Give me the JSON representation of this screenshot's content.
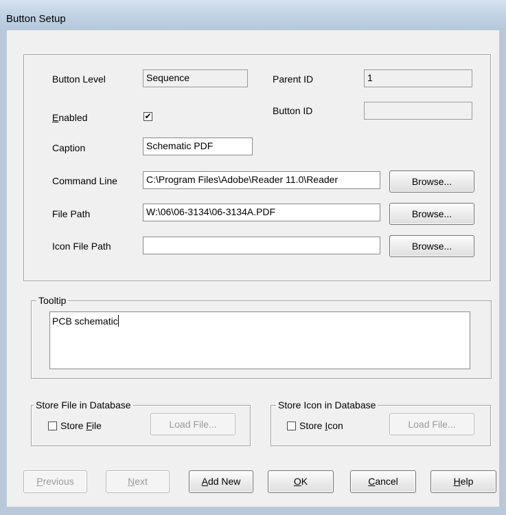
{
  "window": {
    "title": "Button Setup"
  },
  "fields": {
    "button_level_label": "Button Level",
    "button_level_value": "Sequence",
    "parent_id_label": "Parent ID",
    "parent_id_value": "1",
    "enabled_label_mnemonic": "E",
    "enabled_label_rest": "nabled",
    "enabled_checked": true,
    "enabled_mark": "✔",
    "button_id_label": "Button ID",
    "button_id_value": "",
    "caption_label": "Caption",
    "caption_value": "Schematic PDF",
    "command_line_label": "Command Line",
    "command_line_value": "C:\\Program Files\\Adobe\\Reader 11.0\\Reader",
    "file_path_label": "File Path",
    "file_path_value": "W:\\06\\06-3134\\06-3134A.PDF",
    "icon_file_path_label": "Icon File Path",
    "icon_file_path_value": "",
    "browse_label": "Browse..."
  },
  "tooltip": {
    "legend": "Tooltip",
    "value": "PCB schematic"
  },
  "store_file": {
    "legend": "Store File in Database",
    "checkbox_pre": "Store ",
    "checkbox_mnemonic": "F",
    "checkbox_post": "ile",
    "checked": false,
    "load_label": "Load File..."
  },
  "store_icon": {
    "legend": "Store Icon in Database",
    "checkbox_pre": "Store ",
    "checkbox_mnemonic": "I",
    "checkbox_post": "con",
    "checked": false,
    "load_label": "Load File..."
  },
  "footer": {
    "previous_mnemonic": "P",
    "previous_rest": "revious",
    "next_mnemonic": "N",
    "next_rest": "ext",
    "add_new_mnemonic": "A",
    "add_new_rest": "dd New",
    "ok_mnemonic": "O",
    "ok_rest": "K",
    "cancel_mnemonic": "C",
    "cancel_rest": "ancel",
    "help_mnemonic": "H",
    "help_rest": "elp"
  },
  "colors": {
    "title_bar": "#c2d3e6",
    "dialog_bg": "#f0f0f0",
    "disabled_text": "#9a9a9a"
  }
}
